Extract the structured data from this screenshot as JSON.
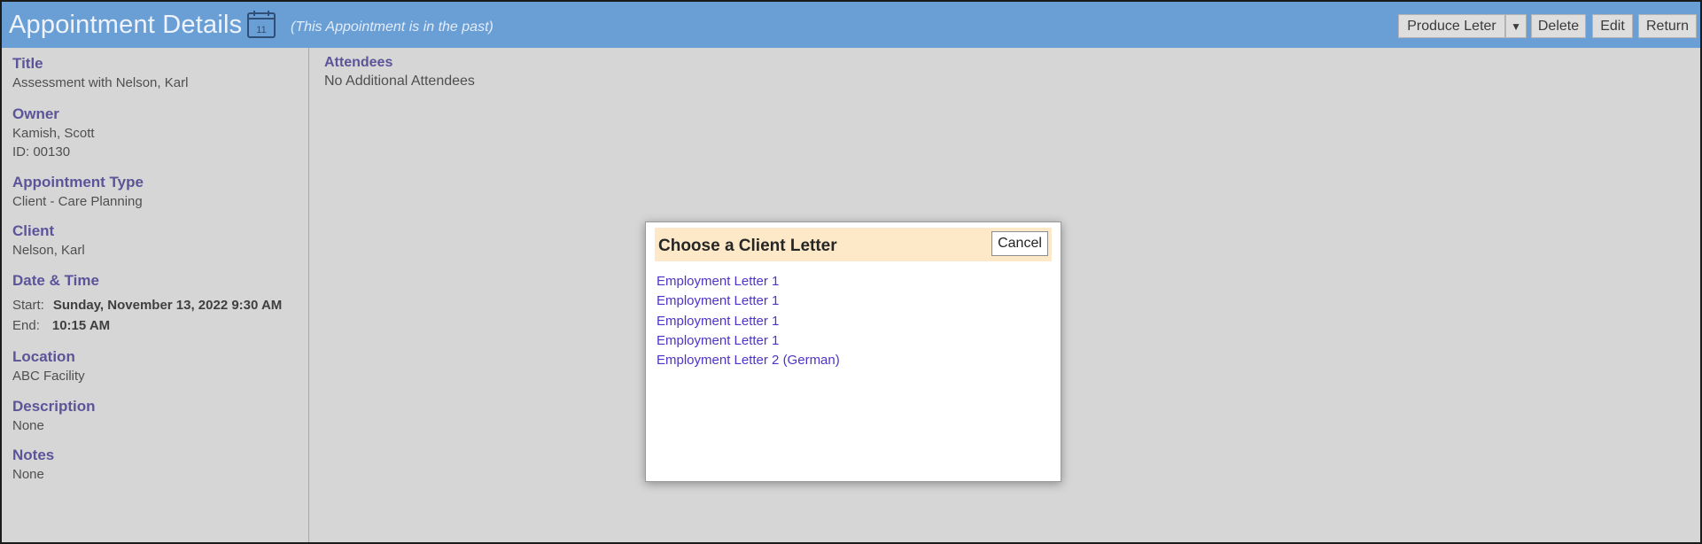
{
  "header": {
    "title": "Appointment Details",
    "calendar_day": "11",
    "past_note": "(This Appointment is in the past)",
    "buttons": {
      "produce_letter": "Produce Leter",
      "dropdown": "▼",
      "delete": "Delete",
      "edit": "Edit",
      "return": "Return"
    }
  },
  "details": {
    "title_label": "Title",
    "title_value": "Assessment with Nelson, Karl",
    "owner_label": "Owner",
    "owner_name": "Kamish, Scott",
    "owner_id": "ID: 00130",
    "type_label": "Appointment Type",
    "type_value": "Client - Care Planning",
    "client_label": "Client",
    "client_value": "Nelson, Karl",
    "datetime_label": "Date & Time",
    "start_label": "Start:",
    "start_value": "Sunday, November 13, 2022 9:30 AM",
    "end_label": "End:",
    "end_value": "10:15 AM",
    "location_label": "Location",
    "location_value": "ABC Facility",
    "description_label": "Description",
    "description_value": "None",
    "notes_label": "Notes",
    "notes_value": "None"
  },
  "attendees": {
    "label": "Attendees",
    "value": "No Additional Attendees"
  },
  "modal": {
    "title": "Choose a Client Letter",
    "cancel_label": "Cancel",
    "letters": [
      "Employment Letter 1",
      "Employment Letter 1",
      "Employment Letter 1",
      "Employment Letter 1",
      "Employment Letter 2 (German)"
    ]
  },
  "colors": {
    "header_bg": "#6a9fd6",
    "label": "#5b5499",
    "link": "#4f32c8",
    "modal_header_bg": "#fde9c7"
  }
}
